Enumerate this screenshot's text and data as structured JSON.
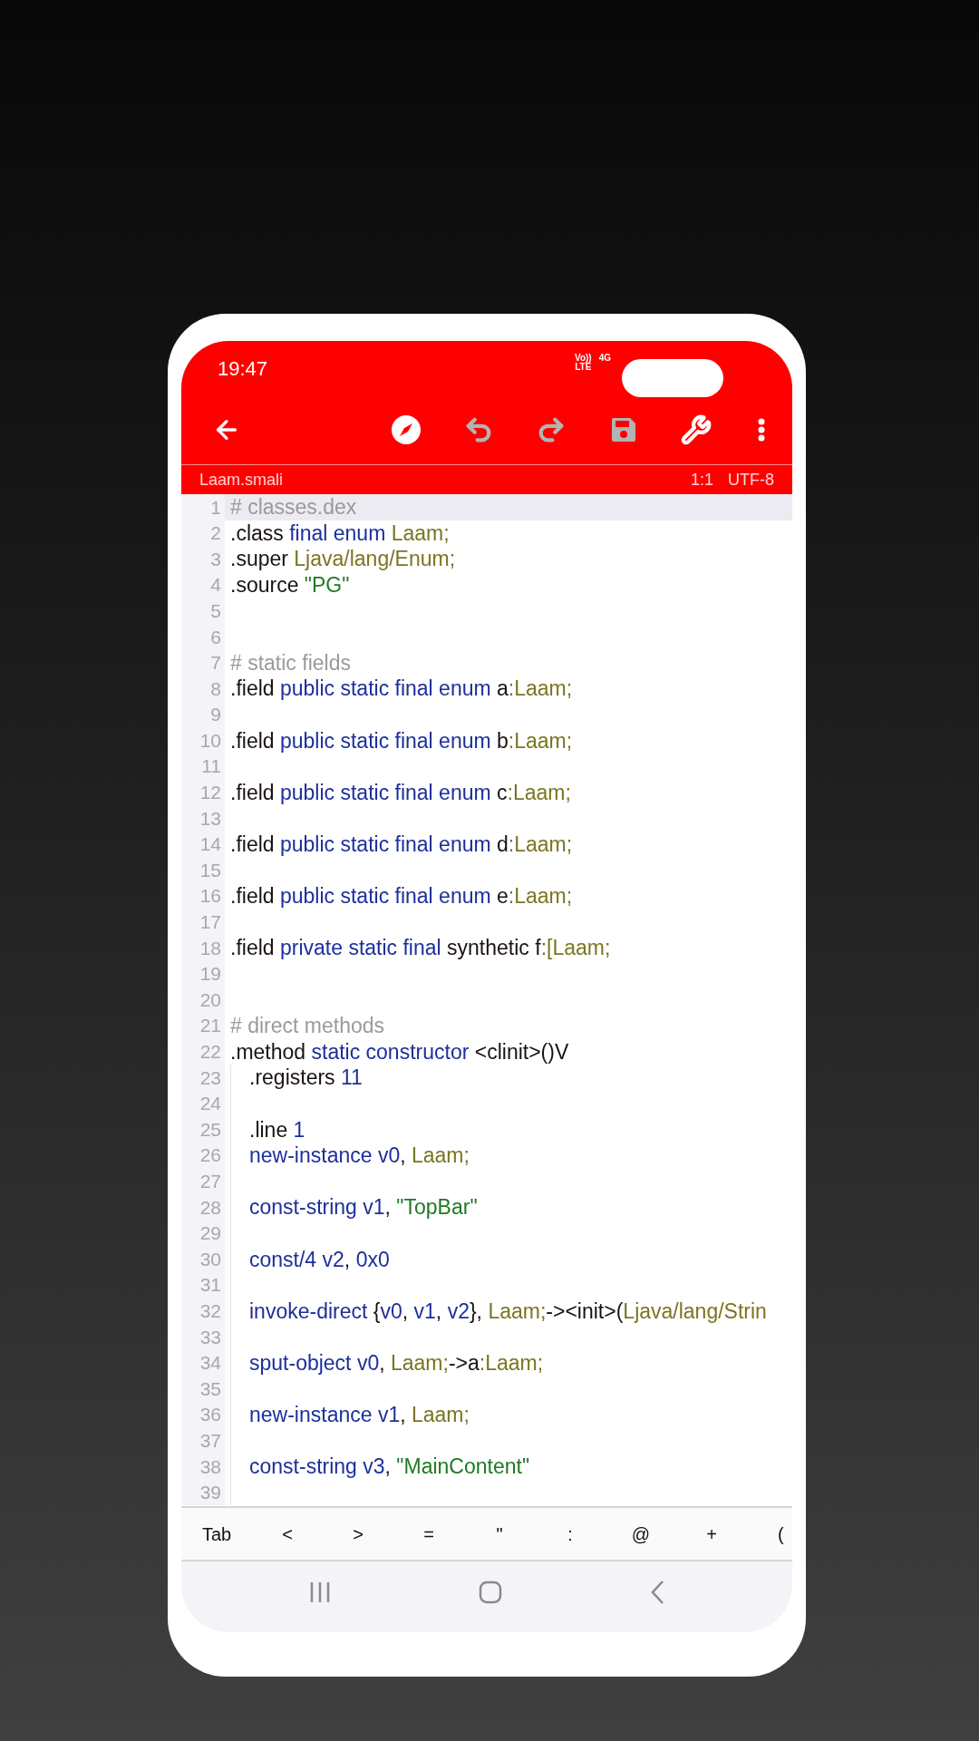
{
  "status_bar": {
    "time": "19:47",
    "network_top": "Vo))",
    "network_bottom": "LTE",
    "data": "4G"
  },
  "toolbar": {
    "actions": [
      {
        "kind": "compass",
        "disabled": false
      },
      {
        "kind": "undo",
        "disabled": true
      },
      {
        "kind": "redo",
        "disabled": true
      },
      {
        "kind": "save",
        "disabled": true
      },
      {
        "kind": "wrench",
        "disabled": false
      },
      {
        "kind": "more",
        "disabled": false
      }
    ]
  },
  "file_bar": {
    "name": "Laam.smali",
    "position": "1:1",
    "encoding": "UTF-8"
  },
  "editor": {
    "lines": [
      {
        "n": "1",
        "current": true,
        "indented": false,
        "tokens": [
          {
            "kind": "comment",
            "text": "# classes.dex"
          }
        ]
      },
      {
        "n": "2",
        "current": false,
        "indented": false,
        "tokens": [
          {
            "kind": "plain",
            "text": ".class "
          },
          {
            "kind": "kw",
            "text": "final enum "
          },
          {
            "kind": "type",
            "text": "Laam;"
          }
        ]
      },
      {
        "n": "3",
        "current": false,
        "indented": false,
        "tokens": [
          {
            "kind": "plain",
            "text": ".super "
          },
          {
            "kind": "type",
            "text": "Ljava/lang/Enum;"
          }
        ]
      },
      {
        "n": "4",
        "current": false,
        "indented": false,
        "tokens": [
          {
            "kind": "plain",
            "text": ".source "
          },
          {
            "kind": "str",
            "text": "\"PG\""
          }
        ]
      },
      {
        "n": "5",
        "current": false,
        "indented": false
      },
      {
        "n": "6",
        "current": false,
        "indented": false
      },
      {
        "n": "7",
        "current": false,
        "indented": false,
        "tokens": [
          {
            "kind": "comment",
            "text": "# static fields"
          }
        ]
      },
      {
        "n": "8",
        "current": false,
        "indented": false,
        "tokens": [
          {
            "kind": "plain",
            "text": ".field "
          },
          {
            "kind": "kw",
            "text": "public static final enum "
          },
          {
            "kind": "plain",
            "text": "a"
          },
          {
            "kind": "type",
            "text": ":Laam;"
          }
        ]
      },
      {
        "n": "9",
        "current": false,
        "indented": false
      },
      {
        "n": "10",
        "current": false,
        "indented": false,
        "tokens": [
          {
            "kind": "plain",
            "text": ".field "
          },
          {
            "kind": "kw",
            "text": "public static final enum "
          },
          {
            "kind": "plain",
            "text": "b"
          },
          {
            "kind": "type",
            "text": ":Laam;"
          }
        ]
      },
      {
        "n": "11",
        "current": false,
        "indented": false
      },
      {
        "n": "12",
        "current": false,
        "indented": false,
        "tokens": [
          {
            "kind": "plain",
            "text": ".field "
          },
          {
            "kind": "kw",
            "text": "public static final enum "
          },
          {
            "kind": "plain",
            "text": "c"
          },
          {
            "kind": "type",
            "text": ":Laam;"
          }
        ]
      },
      {
        "n": "13",
        "current": false,
        "indented": false
      },
      {
        "n": "14",
        "current": false,
        "indented": false,
        "tokens": [
          {
            "kind": "plain",
            "text": ".field "
          },
          {
            "kind": "kw",
            "text": "public static final enum "
          },
          {
            "kind": "plain",
            "text": "d"
          },
          {
            "kind": "type",
            "text": ":Laam;"
          }
        ]
      },
      {
        "n": "15",
        "current": false,
        "indented": false
      },
      {
        "n": "16",
        "current": false,
        "indented": false,
        "tokens": [
          {
            "kind": "plain",
            "text": ".field "
          },
          {
            "kind": "kw",
            "text": "public static final enum "
          },
          {
            "kind": "plain",
            "text": "e"
          },
          {
            "kind": "type",
            "text": ":Laam;"
          }
        ]
      },
      {
        "n": "17",
        "current": false,
        "indented": false
      },
      {
        "n": "18",
        "current": false,
        "indented": false,
        "tokens": [
          {
            "kind": "plain",
            "text": ".field "
          },
          {
            "kind": "kw",
            "text": "private static final "
          },
          {
            "kind": "plain",
            "text": "synthetic f"
          },
          {
            "kind": "type",
            "text": ":[Laam;"
          }
        ]
      },
      {
        "n": "19",
        "current": false,
        "indented": false
      },
      {
        "n": "20",
        "current": false,
        "indented": false
      },
      {
        "n": "21",
        "current": false,
        "indented": false,
        "tokens": [
          {
            "kind": "comment",
            "text": "# direct methods"
          }
        ]
      },
      {
        "n": "22",
        "current": false,
        "indented": false,
        "tokens": [
          {
            "kind": "plain",
            "text": ".method "
          },
          {
            "kind": "kw",
            "text": "static constructor "
          },
          {
            "kind": "plain",
            "text": "<clinit>()V"
          }
        ]
      },
      {
        "n": "23",
        "current": false,
        "indented": true,
        "tokens": [
          {
            "kind": "plain",
            "text": ".registers "
          },
          {
            "kind": "kw",
            "text": "11"
          }
        ]
      },
      {
        "n": "24",
        "current": false,
        "indented": true
      },
      {
        "n": "25",
        "current": false,
        "indented": true,
        "tokens": [
          {
            "kind": "plain",
            "text": ".line "
          },
          {
            "kind": "kw",
            "text": "1"
          }
        ]
      },
      {
        "n": "26",
        "current": false,
        "indented": true,
        "tokens": [
          {
            "kind": "kw",
            "text": "new-instance v0"
          },
          {
            "kind": "plain",
            "text": ", "
          },
          {
            "kind": "type",
            "text": "Laam;"
          }
        ]
      },
      {
        "n": "27",
        "current": false,
        "indented": true
      },
      {
        "n": "28",
        "current": false,
        "indented": true,
        "tokens": [
          {
            "kind": "kw",
            "text": "const-string v1"
          },
          {
            "kind": "plain",
            "text": ", "
          },
          {
            "kind": "str",
            "text": "\"TopBar\""
          }
        ]
      },
      {
        "n": "29",
        "current": false,
        "indented": true
      },
      {
        "n": "30",
        "current": false,
        "indented": true,
        "tokens": [
          {
            "kind": "kw",
            "text": "const/4 v2"
          },
          {
            "kind": "plain",
            "text": ", "
          },
          {
            "kind": "kw",
            "text": "0x0"
          }
        ]
      },
      {
        "n": "31",
        "current": false,
        "indented": true
      },
      {
        "n": "32",
        "current": false,
        "indented": true,
        "tokens": [
          {
            "kind": "kw",
            "text": "invoke-direct "
          },
          {
            "kind": "plain",
            "text": "{"
          },
          {
            "kind": "kw",
            "text": "v0"
          },
          {
            "kind": "plain",
            "text": ", "
          },
          {
            "kind": "kw",
            "text": "v1"
          },
          {
            "kind": "plain",
            "text": ", "
          },
          {
            "kind": "kw",
            "text": "v2"
          },
          {
            "kind": "plain",
            "text": "}, "
          },
          {
            "kind": "type",
            "text": "Laam;"
          },
          {
            "kind": "plain",
            "text": "-><init>("
          },
          {
            "kind": "type",
            "text": "Ljava/lang/Strin"
          }
        ]
      },
      {
        "n": "33",
        "current": false,
        "indented": true
      },
      {
        "n": "34",
        "current": false,
        "indented": true,
        "tokens": [
          {
            "kind": "kw",
            "text": "sput-object v0"
          },
          {
            "kind": "plain",
            "text": ", "
          },
          {
            "kind": "type",
            "text": "Laam;"
          },
          {
            "kind": "plain",
            "text": "->a"
          },
          {
            "kind": "type",
            "text": ":Laam;"
          }
        ]
      },
      {
        "n": "35",
        "current": false,
        "indented": true
      },
      {
        "n": "36",
        "current": false,
        "indented": true,
        "tokens": [
          {
            "kind": "kw",
            "text": "new-instance v1"
          },
          {
            "kind": "plain",
            "text": ", "
          },
          {
            "kind": "type",
            "text": "Laam;"
          }
        ]
      },
      {
        "n": "37",
        "current": false,
        "indented": true
      },
      {
        "n": "38",
        "current": false,
        "indented": true,
        "tokens": [
          {
            "kind": "kw",
            "text": "const-string v3"
          },
          {
            "kind": "plain",
            "text": ", "
          },
          {
            "kind": "str",
            "text": "\"MainContent\""
          }
        ]
      },
      {
        "n": "39",
        "current": false,
        "indented": true
      }
    ]
  },
  "key_bar": [
    "Tab",
    "<",
    ">",
    "=",
    "\"",
    ":",
    "@",
    "+",
    "("
  ]
}
